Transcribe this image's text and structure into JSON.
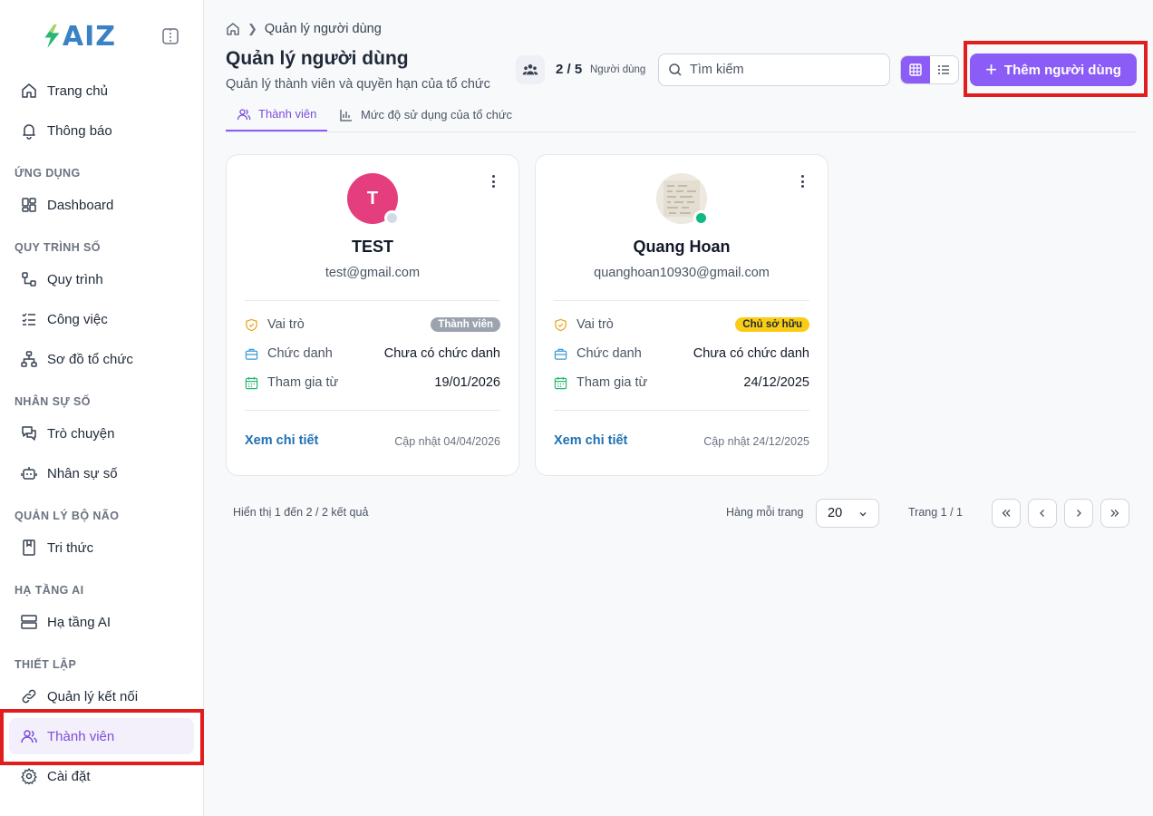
{
  "app": {
    "logo_text": "AIZ",
    "colors": {
      "accent": "#8b5cf6",
      "active_text": "#7c4ddb",
      "link": "#1f6fb5",
      "highlight": "#e11d1d"
    }
  },
  "sidebar": {
    "top_items": [
      {
        "label": "Trang chủ",
        "icon": "home-icon"
      },
      {
        "label": "Thông báo",
        "icon": "bell-icon"
      }
    ],
    "sections": [
      {
        "title": "ỨNG DỤNG",
        "items": [
          {
            "label": "Dashboard",
            "icon": "dashboard-icon"
          }
        ]
      },
      {
        "title": "QUY TRÌNH SỐ",
        "items": [
          {
            "label": "Quy trình",
            "icon": "workflow-icon"
          },
          {
            "label": "Công việc",
            "icon": "tasks-icon"
          },
          {
            "label": "Sơ đồ tổ chức",
            "icon": "org-chart-icon"
          }
        ]
      },
      {
        "title": "NHÂN SỰ SỐ",
        "items": [
          {
            "label": "Trò chuyện",
            "icon": "chat-icon"
          },
          {
            "label": "Nhân sự số",
            "icon": "bot-icon"
          }
        ]
      },
      {
        "title": "QUẢN LÝ BỘ NÃO",
        "items": [
          {
            "label": "Tri thức",
            "icon": "book-icon"
          }
        ]
      },
      {
        "title": "HẠ TẦNG AI",
        "items": [
          {
            "label": "Hạ tầng AI",
            "icon": "server-icon"
          }
        ]
      },
      {
        "title": "THIẾT LẬP",
        "items": [
          {
            "label": "Quản lý kết nối",
            "icon": "link-icon"
          },
          {
            "label": "Thành viên",
            "icon": "users-icon",
            "active": true
          },
          {
            "label": "Cài đặt",
            "icon": "gear-icon"
          }
        ]
      }
    ]
  },
  "header": {
    "breadcrumb": "Quản lý người dùng",
    "title": "Quản lý người dùng",
    "subtitle": "Quản lý thành viên và quyền hạn của tổ chức",
    "user_count": "2 / 5",
    "user_count_label": "Người dùng",
    "search_placeholder": "Tìm kiếm",
    "add_button": "Thêm người dùng"
  },
  "tabs": [
    {
      "label": "Thành viên",
      "active": true
    },
    {
      "label": "Mức độ sử dụng của tổ chức",
      "active": false
    }
  ],
  "labels": {
    "role": "Vai trò",
    "position": "Chức danh",
    "joined": "Tham gia từ",
    "view_detail": "Xem chi tiết"
  },
  "members": [
    {
      "initial": "T",
      "name": "TEST",
      "email": "test@gmail.com",
      "role": "Thành viên",
      "position": "Chưa có chức danh",
      "joined": "19/01/2026",
      "updated": "Cập nhật 04/04/2026",
      "online": false
    },
    {
      "initial": "",
      "name": "Quang Hoan",
      "email": "quanghoan10930@gmail.com",
      "role": "Chủ sở hữu",
      "position": "Chưa có chức danh",
      "joined": "24/12/2025",
      "updated": "Cập nhật 24/12/2025",
      "online": true
    }
  ],
  "pagination": {
    "summary": "Hiển thị 1 đến 2 / 2 kết quả",
    "per_page_label": "Hàng mỗi trang",
    "per_page_value": "20",
    "page_label": "Trang 1 / 1"
  }
}
